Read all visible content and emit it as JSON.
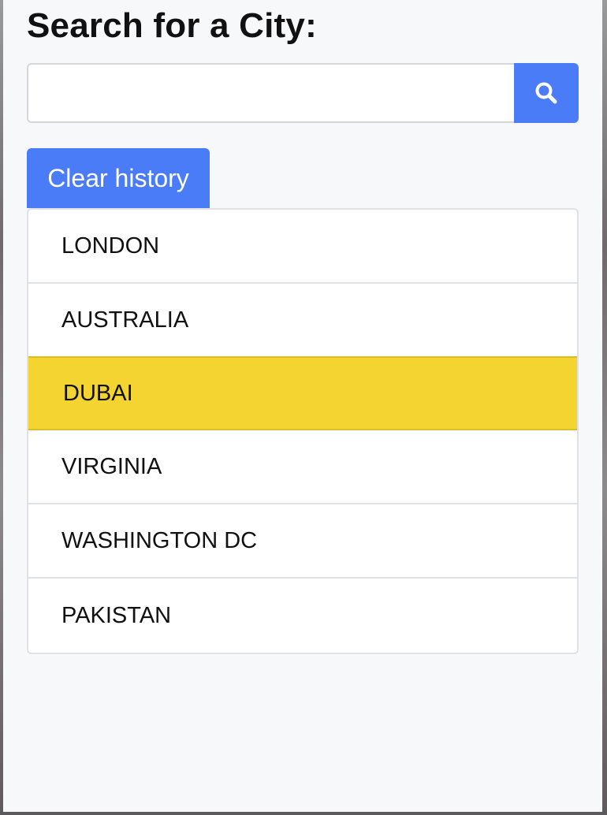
{
  "header": {
    "title": "Search for a City:"
  },
  "search": {
    "value": "",
    "placeholder": "",
    "button_icon": "search-icon"
  },
  "history": {
    "clear_label": "Clear history",
    "items": [
      {
        "label": "LONDON",
        "active": false
      },
      {
        "label": "AUSTRALIA",
        "active": false
      },
      {
        "label": "DUBAI",
        "active": true
      },
      {
        "label": "VIRGINIA",
        "active": false
      },
      {
        "label": "WASHINGTON DC",
        "active": false
      },
      {
        "label": "PAKISTAN",
        "active": false
      }
    ]
  },
  "colors": {
    "accent": "#4a7cf7",
    "active_item": "#f4d430",
    "panel_bg": "#f7f8fa"
  }
}
